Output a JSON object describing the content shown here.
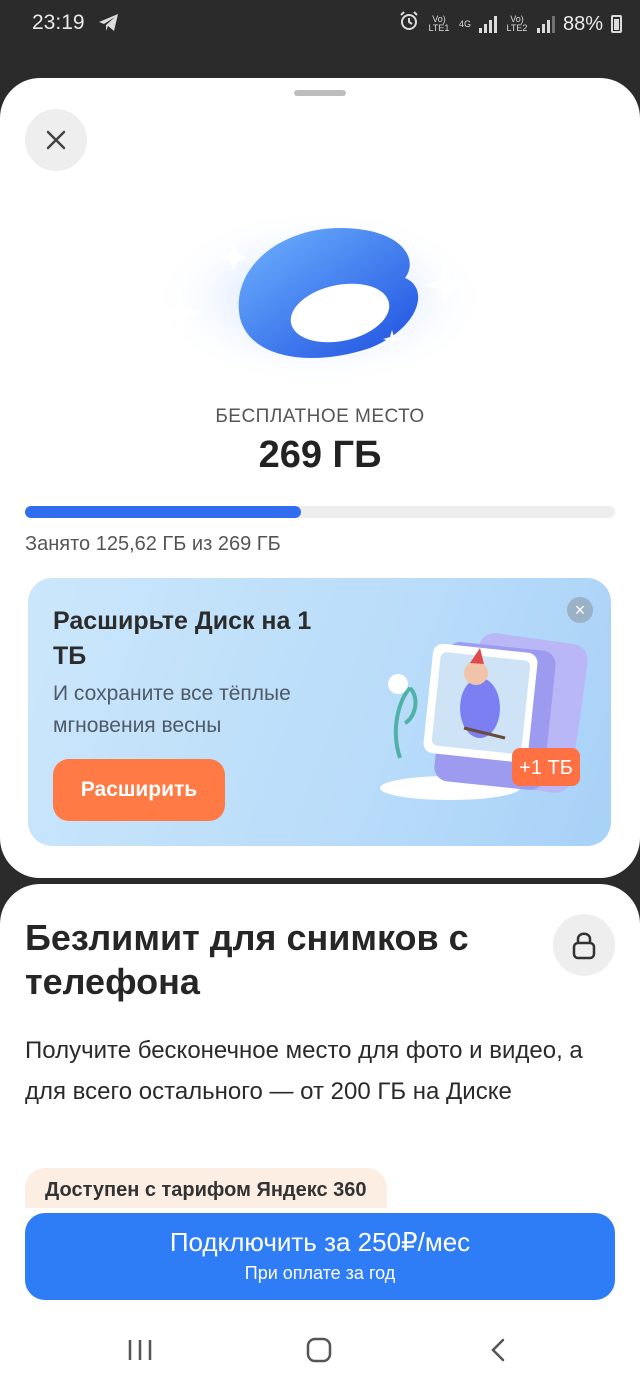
{
  "status_bar": {
    "time": "23:19",
    "telegram_icon": "telegram-icon",
    "alarm_icon": "alarm-icon",
    "sim1": "Vo) LTE1",
    "net": "4G",
    "sim2": "Vo) LTE2",
    "battery": "88%"
  },
  "sheet": {
    "close_icon": "close-icon",
    "space_label": "БЕСПЛАТНОЕ МЕСТО",
    "space_value": "269 ГБ",
    "usage_fraction": 0.467,
    "usage_text": "Занято 125,62 ГБ из 269 ГБ"
  },
  "promo": {
    "title": "Расширьте Диск на 1 ТБ",
    "subtitle": "И сохраните все тёплые мгновения весны",
    "button_label": "Расширить",
    "badge": "+1 ТБ"
  },
  "card": {
    "title": "Безлимит для снимков с телефона",
    "description": "Получите бесконечное место для фото и видео, а для всего остального — от 200 ГБ на Диске",
    "chip": "Доступен с тарифом Яндекс 360",
    "cta_main": "Подключить за 250₽/мес",
    "cta_sub": "При оплате за год"
  },
  "colors": {
    "accent_blue": "#2f7df6",
    "progress_blue": "#2f6ef0",
    "promo_orange": "#ff7a45"
  }
}
